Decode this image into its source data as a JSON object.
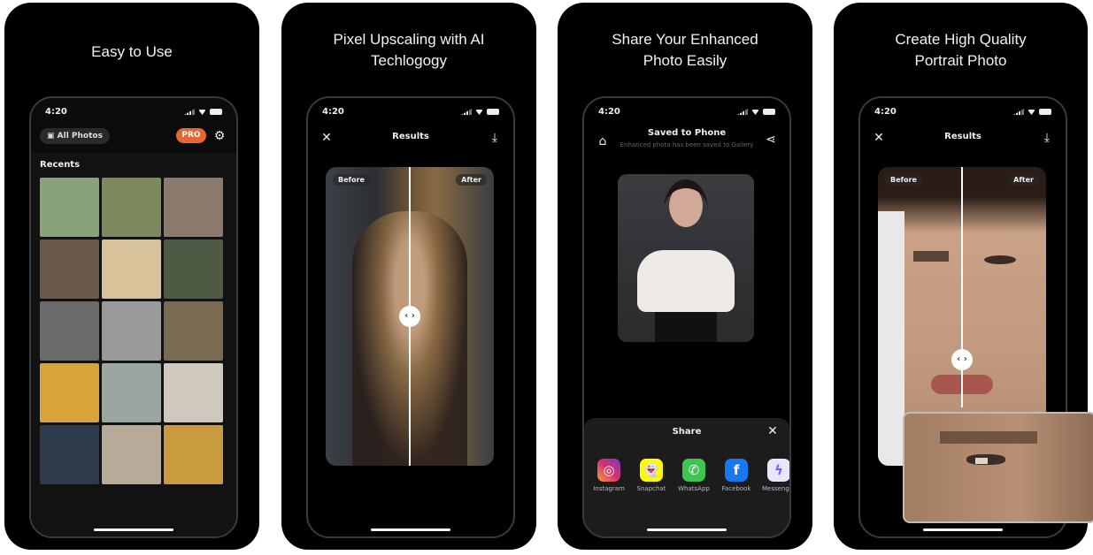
{
  "panels": [
    {
      "headline": "Easy to Use",
      "status": {
        "time": "4:20"
      },
      "album_button": "All Photos",
      "pro_badge": "PRO",
      "section_title": "Recents",
      "thumb_colors": [
        "#8aa27a",
        "#7c8a5e",
        "#8c7a6e",
        "#6b5a4a",
        "#d7c29a",
        "#4e5a44",
        "#6a6a6a",
        "#9a9a9a",
        "#7a6a52",
        "#d9a43a",
        "#9aa6a0",
        "#cfc8bc",
        "#2d3a4c",
        "#b7aa98",
        "#c99a3e"
      ]
    },
    {
      "headline_line1": "Pixel Upscaling with AI",
      "headline_line2": "Techlogogy",
      "status": {
        "time": "4:20"
      },
      "title": "Results",
      "before_label": "Before",
      "after_label": "After",
      "handle_glyph": "‹ ›"
    },
    {
      "headline_line1": "Share Your Enhanced",
      "headline_line2": "Photo Easily",
      "status": {
        "time": "4:20"
      },
      "title": "Saved to Phone",
      "subtitle": "Enhanced photo has been saved to Gallery",
      "share_title": "Share",
      "apps": [
        {
          "label": "Instagram",
          "glyph": "◎",
          "color": "#d6306f"
        },
        {
          "label": "Snapchat",
          "glyph": "👻",
          "color": "#fffc00"
        },
        {
          "label": "WhatsApp",
          "glyph": "✆",
          "color": "#3fc351"
        },
        {
          "label": "Facebook",
          "glyph": "f",
          "color": "#1877f2"
        },
        {
          "label": "Messenger",
          "glyph": "ϟ",
          "color": "#e9e6fb"
        }
      ]
    },
    {
      "headline_line1": "Create High Quality",
      "headline_line2": "Portrait Photo",
      "status": {
        "time": "4:20"
      },
      "title": "Results",
      "before_label": "Before",
      "after_label": "After",
      "handle_glyph": "‹ ›"
    }
  ]
}
